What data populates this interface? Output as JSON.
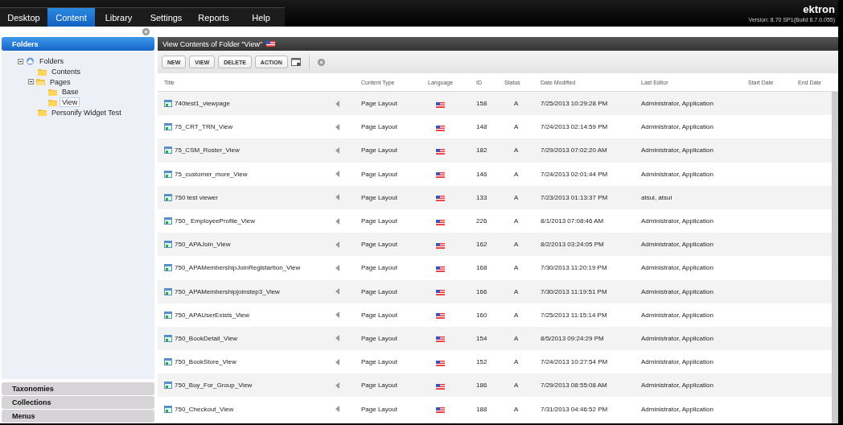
{
  "nav_tabs": [
    {
      "label": "Desktop",
      "selected": false
    },
    {
      "label": "Content",
      "selected": true
    },
    {
      "label": "Library",
      "selected": false
    },
    {
      "label": "Settings",
      "selected": false
    },
    {
      "label": "Reports",
      "selected": false
    },
    {
      "label": "Help",
      "selected": false
    }
  ],
  "brand": {
    "logo": "ektron",
    "version": "Version: 8.70 SP1(Build 8.7.0.055)"
  },
  "sidebar": {
    "sections": [
      {
        "label": "Folders",
        "selected": true,
        "tree": [
          {
            "label": "Folders",
            "kind": "root",
            "expanded": true,
            "selected": false,
            "children": [
              {
                "label": "Contents",
                "kind": "folder",
                "selected": false
              },
              {
                "label": "Pages",
                "kind": "folder",
                "expanded": true,
                "selected": false,
                "children": [
                  {
                    "label": "Base",
                    "kind": "folder",
                    "selected": false
                  },
                  {
                    "label": "View",
                    "kind": "folder",
                    "selected": true
                  }
                ]
              },
              {
                "label": "Personify Widget Test",
                "kind": "folder",
                "selected": false
              }
            ]
          }
        ]
      },
      {
        "label": "Taxonomies",
        "selected": false
      },
      {
        "label": "Collections",
        "selected": false
      },
      {
        "label": "Menus",
        "selected": false
      }
    ]
  },
  "content": {
    "title": "View Contents of Folder \"View\"",
    "toolbar": [
      "NEW",
      "VIEW",
      "DELETE",
      "ACTION"
    ],
    "table": {
      "columns": [
        "Title",
        "",
        "Content Type",
        "Language",
        "ID",
        "Status",
        "Date Modified",
        "Last Editor",
        "Start Date",
        "End Date"
      ],
      "rows": [
        {
          "title": "740test1_viewpage",
          "type": "Page Layout",
          "id": "158",
          "status": "A",
          "modified": "7/25/2013 10:29:28 PM",
          "editor": "Administrator, Application"
        },
        {
          "title": "75_CRT_TRN_View",
          "type": "Page Layout",
          "id": "148",
          "status": "A",
          "modified": "7/24/2013 02:14:59 PM",
          "editor": "Administrator, Application"
        },
        {
          "title": "75_CSM_Roster_View",
          "type": "Page Layout",
          "id": "182",
          "status": "A",
          "modified": "7/29/2013 07:02:20 AM",
          "editor": "Administrator, Application"
        },
        {
          "title": "75_customer_more_View",
          "type": "Page Layout",
          "id": "146",
          "status": "A",
          "modified": "7/24/2013 02:01:44 PM",
          "editor": "Administrator, Application"
        },
        {
          "title": "750 test viewer",
          "type": "Page Layout",
          "id": "133",
          "status": "A",
          "modified": "7/23/2013 01:13:37 PM",
          "editor": "atsui, atsui"
        },
        {
          "title": "750_ EmployeeProfile_View",
          "type": "Page Layout",
          "id": "226",
          "status": "A",
          "modified": "8/1/2013 07:08:46 AM",
          "editor": "Administrator, Application"
        },
        {
          "title": "750_APAJoin_View",
          "type": "Page Layout",
          "id": "162",
          "status": "A",
          "modified": "8/2/2013 03:24:05 PM",
          "editor": "Administrator, Application"
        },
        {
          "title": "750_APAMembershipJoinRegistartion_View",
          "type": "Page Layout",
          "id": "168",
          "status": "A",
          "modified": "7/30/2013 11:20:19 PM",
          "editor": "Administrator, Application"
        },
        {
          "title": "750_APAMembershipjoinstep3_View",
          "type": "Page Layout",
          "id": "166",
          "status": "A",
          "modified": "7/30/2013 11:19:51 PM",
          "editor": "Administrator, Application"
        },
        {
          "title": "750_APAUserExists_View",
          "type": "Page Layout",
          "id": "160",
          "status": "A",
          "modified": "7/25/2013 11:15:14 PM",
          "editor": "Administrator, Application"
        },
        {
          "title": "750_BookDetail_View",
          "type": "Page Layout",
          "id": "154",
          "status": "A",
          "modified": "8/5/2013 09:24:29 PM",
          "editor": "Administrator, Application"
        },
        {
          "title": "750_BookStore_View",
          "type": "Page Layout",
          "id": "152",
          "status": "A",
          "modified": "7/24/2013 10:27:54 PM",
          "editor": "Administrator, Application"
        },
        {
          "title": "750_Buy_For_Group_View",
          "type": "Page Layout",
          "id": "186",
          "status": "A",
          "modified": "7/29/2013 08:55:08 AM",
          "editor": "Administrator, Application"
        },
        {
          "title": "750_Checkout_View",
          "type": "Page Layout",
          "id": "188",
          "status": "A",
          "modified": "7/31/2013 04:46:52 PM",
          "editor": "Administrator, Application"
        }
      ]
    }
  }
}
